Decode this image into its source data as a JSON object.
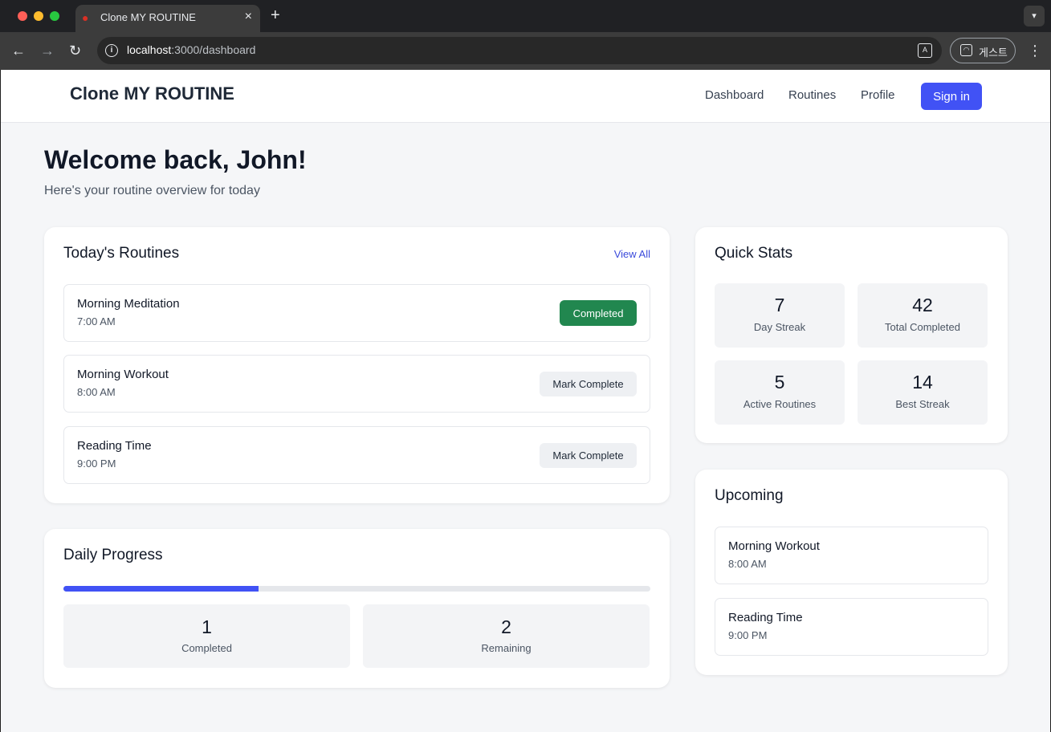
{
  "browser": {
    "tab_title": "Clone MY ROUTINE",
    "tab_icon": "cherry-icon",
    "url_host": "localhost",
    "url_path": ":3000/dashboard",
    "profile_label": "게스트"
  },
  "header": {
    "brand": "Clone MY ROUTINE",
    "nav": {
      "dashboard": "Dashboard",
      "routines": "Routines",
      "profile": "Profile"
    },
    "signin": "Sign in"
  },
  "welcome": {
    "title": "Welcome back, John!",
    "subtitle": "Here's your routine overview for today"
  },
  "today": {
    "title": "Today's Routines",
    "view_all": "View All",
    "items": [
      {
        "name": "Morning Meditation",
        "time": "7:00 AM",
        "action": "Completed",
        "status": "completed"
      },
      {
        "name": "Morning Workout",
        "time": "8:00 AM",
        "action": "Mark Complete",
        "status": "pending"
      },
      {
        "name": "Reading Time",
        "time": "9:00 PM",
        "action": "Mark Complete",
        "status": "pending"
      }
    ]
  },
  "progress": {
    "title": "Daily Progress",
    "fraction": 0.333,
    "completed_value": "1",
    "completed_label": "Completed",
    "remaining_value": "2",
    "remaining_label": "Remaining"
  },
  "stats": {
    "title": "Quick Stats",
    "items": [
      {
        "value": "7",
        "label": "Day Streak"
      },
      {
        "value": "42",
        "label": "Total Completed"
      },
      {
        "value": "5",
        "label": "Active Routines"
      },
      {
        "value": "14",
        "label": "Best Streak"
      }
    ]
  },
  "upcoming": {
    "title": "Upcoming",
    "items": [
      {
        "name": "Morning Workout",
        "time": "8:00 AM"
      },
      {
        "name": "Reading Time",
        "time": "9:00 PM"
      }
    ]
  },
  "colors": {
    "accent": "#4152f5",
    "success": "#21874f",
    "background": "#f5f6f8"
  }
}
